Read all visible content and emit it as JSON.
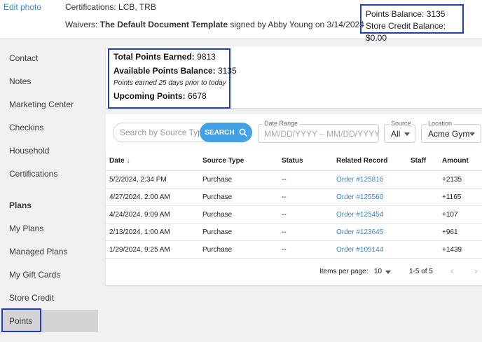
{
  "header": {
    "edit_photo": "Edit photo",
    "certifications_label": "Certifications:",
    "certifications_value": "LCB, TRB",
    "waivers_label": "Waivers:",
    "waivers_doc": "The Default Document Template",
    "waivers_suffix": "signed by Abby Young on 3/14/2024",
    "points_balance_label": "Points Balance:",
    "points_balance_value": "3135",
    "store_credit_label": "Store Credit Balance:",
    "store_credit_value": "$0.00"
  },
  "sidebar": {
    "items": [
      {
        "label": "Contact"
      },
      {
        "label": "Notes"
      },
      {
        "label": "Marketing Center"
      },
      {
        "label": "Checkins"
      },
      {
        "label": "Household"
      },
      {
        "label": "Certifications"
      }
    ],
    "plans_header": "Plans",
    "plan_items": [
      {
        "label": "My Plans"
      },
      {
        "label": "Managed Plans"
      },
      {
        "label": "My Gift Cards"
      },
      {
        "label": "Store Credit"
      },
      {
        "label": "Points"
      }
    ]
  },
  "summary": {
    "total_earned_label": "Total Points Earned:",
    "total_earned_value": "9813",
    "available_label": "Available Points Balance:",
    "available_value": "3135",
    "note": "Points earned 25 days prior to today",
    "upcoming_label": "Upcoming Points:",
    "upcoming_value": "6678"
  },
  "filters": {
    "search_placeholder": "Search by Source Type",
    "search_button": "SEARCH",
    "date_range_label": "Date Range",
    "date_range_text": "MM/DD/YYYY – MM/DD/YYYY",
    "source_label": "Source",
    "source_value": "All",
    "location_label": "Location",
    "location_value": "Acme Gym"
  },
  "table": {
    "columns": [
      "Date",
      "Source Type",
      "Status",
      "Related Record",
      "Staff",
      "Amount"
    ],
    "rows": [
      {
        "date": "5/2/2024, 2:34 PM",
        "source": "Purchase",
        "status": "--",
        "record": "Order #125816",
        "staff": "",
        "amount": "+2135"
      },
      {
        "date": "4/27/2024, 2:00 AM",
        "source": "Purchase",
        "status": "--",
        "record": "Order #125560",
        "staff": "",
        "amount": "+1165"
      },
      {
        "date": "4/24/2024, 9:09 AM",
        "source": "Purchase",
        "status": "--",
        "record": "Order #125454",
        "staff": "",
        "amount": "+107"
      },
      {
        "date": "2/13/2024, 1:00 AM",
        "source": "Purchase",
        "status": "--",
        "record": "Order #123645",
        "staff": "",
        "amount": "+961"
      },
      {
        "date": "1/29/2024, 9:25 AM",
        "source": "Purchase",
        "status": "--",
        "record": "Order #105144",
        "staff": "",
        "amount": "+1439"
      }
    ],
    "items_per_page_label": "Items per page:",
    "items_per_page_value": "10",
    "range_text": "1-5 of 5"
  },
  "colors": {
    "accent": "#45a1e6",
    "link": "#3a86c9",
    "highlight_frame": "#1f3fb5"
  }
}
